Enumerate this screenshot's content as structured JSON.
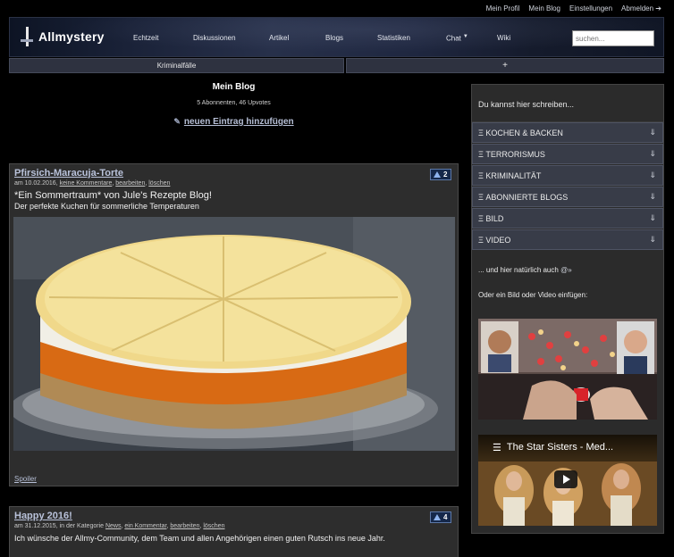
{
  "toplinks": [
    "Mein Profil",
    "Mein Blog",
    "Einstellungen",
    "Abmelden ➔"
  ],
  "logo_text": "Allmystery",
  "nav": [
    "Echtzeit",
    "Diskussionen",
    "Artikel",
    "Blogs",
    "Statistiken",
    "Chat",
    "Wiki"
  ],
  "search_placeholder": "suchen...",
  "subbar": {
    "left": "Kriminalfälle",
    "right": "+"
  },
  "blog": {
    "title": "Mein Blog",
    "stats": "5 Abonnenten, 46 Upvotes",
    "new_entry": "neuen Eintrag hinzufügen"
  },
  "posts": [
    {
      "title": "Pfirsich-Maracuja-Torte",
      "votes": "2",
      "meta_date": "am 10.02.2016,",
      "meta_links": [
        "keine Kommentare",
        "bearbeiten",
        "löschen"
      ],
      "text_line1": "*Ein Sommertraum* von Jule's Rezepte Blog!",
      "text_line2": "Der perfekte Kuchen für sommerliche Temperaturen",
      "spoiler": "Spoiler"
    },
    {
      "title": "Happy 2016!",
      "votes": "4",
      "meta_date": "am 31.12.2015, in der Kategorie",
      "meta_links": [
        "News",
        "ein Kommentar",
        "bearbeiten",
        "löschen"
      ],
      "text_line1": "Ich wünsche der Allmy-Community, dem Team und allen Angehörigen einen guten Rutsch ins neue Jahr."
    }
  ],
  "sidebar": {
    "intro": "Du kannst hier schreiben...",
    "categories": [
      "Kochen & Backen",
      "Terrorismus",
      "Kriminalität",
      "Abonnierte Blogs",
      "Bild",
      "Video"
    ],
    "text1": "... und hier natürlich auch",
    "text2": "Oder ein Bild oder Video einfügen:",
    "video_title": "The Star Sisters - Med..."
  },
  "colors": {
    "bg": "#000000",
    "card": "#2d2d2d",
    "link": "#b9c2da",
    "vote_bg": "#15284a"
  }
}
